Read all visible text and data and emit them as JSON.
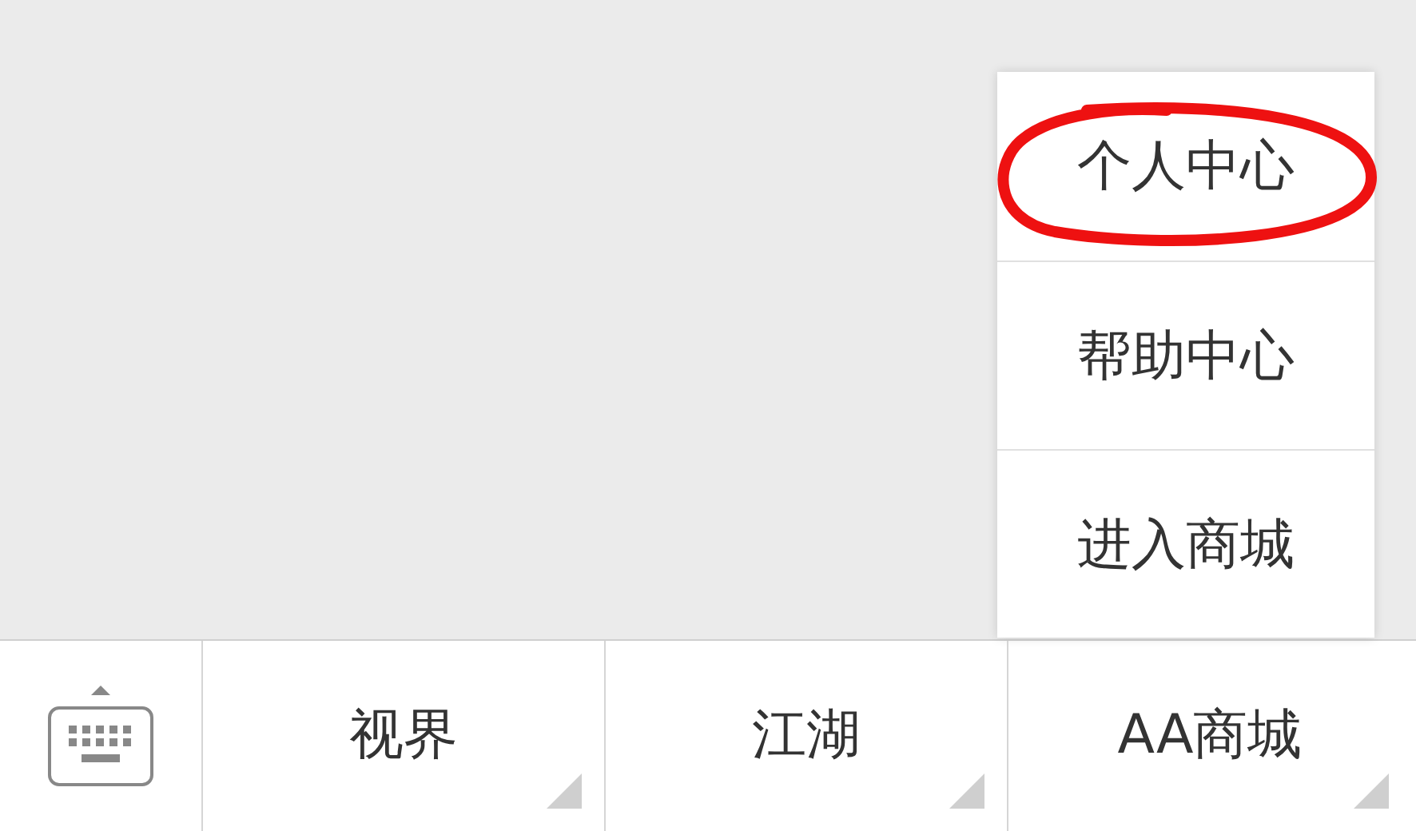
{
  "popup_menu": {
    "items": [
      {
        "label": "个人中心",
        "circled": true
      },
      {
        "label": "帮助中心",
        "circled": false
      },
      {
        "label": "进入商城",
        "circled": false
      }
    ]
  },
  "bottom_bar": {
    "items": [
      {
        "label": "视界",
        "expanded": false
      },
      {
        "label": "江湖",
        "expanded": false
      },
      {
        "label": "AA商城",
        "expanded": true
      }
    ]
  }
}
